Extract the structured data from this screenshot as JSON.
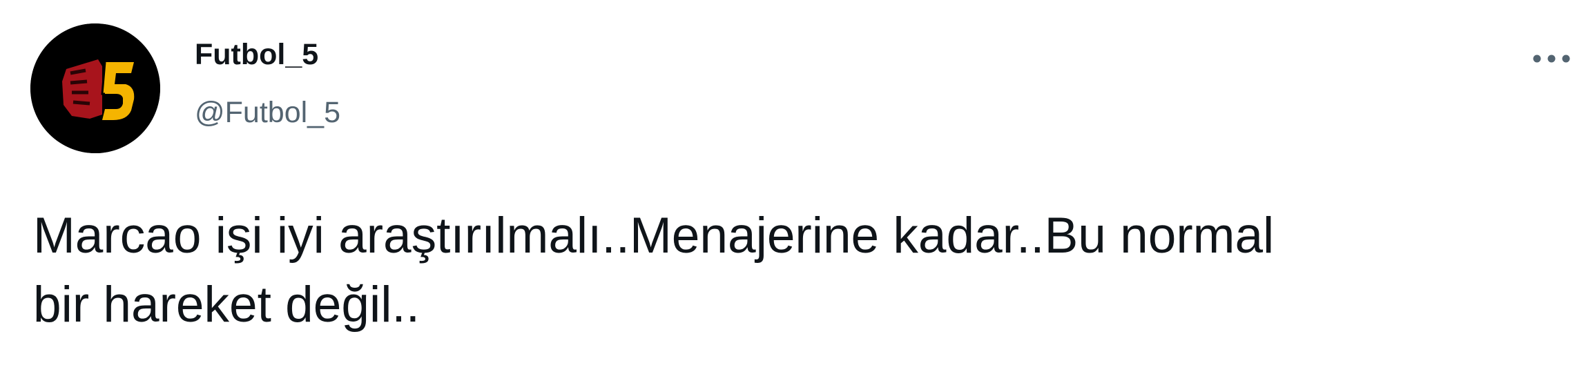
{
  "tweet": {
    "author": {
      "display_name": "Futbol_5",
      "handle": "@Futbol_5",
      "avatar_icon": "futbol5-logo-avatar"
    },
    "text": "Marcao işi iyi araştırılmalı..Menajerine kadar..Bu normal\nbir hareket değil..",
    "more_icon": "more-horizontal-icon"
  },
  "colors": {
    "text_primary": "#0f1419",
    "text_secondary": "#536471",
    "logo_red": "#a8141c",
    "logo_yellow": "#f5b400"
  }
}
